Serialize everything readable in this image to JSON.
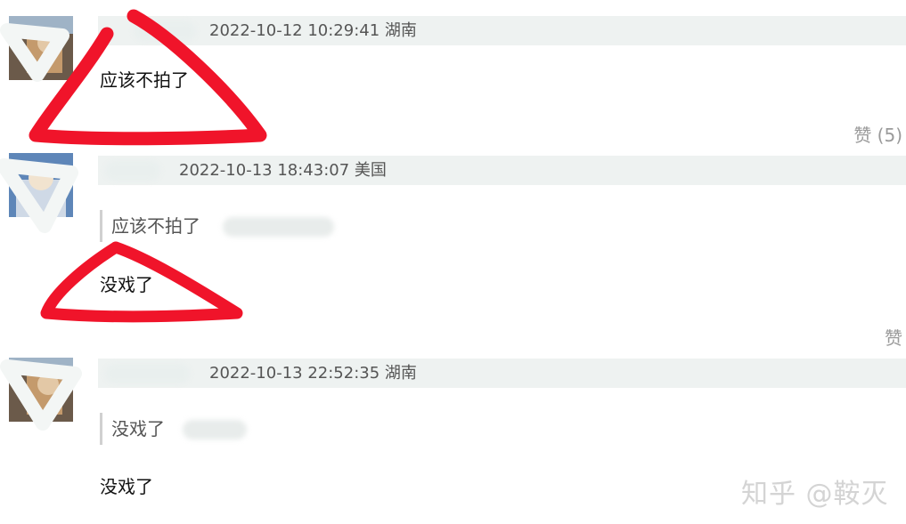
{
  "comments": [
    {
      "time": "2022-10-12 10:29:41",
      "location": "湖南",
      "text": "应该不拍了",
      "like_label": "赞 (5)"
    },
    {
      "time": "2022-10-13 18:43:07",
      "location": "美国",
      "quote": "应该不拍了",
      "text": "没戏了",
      "like_label": "赞"
    },
    {
      "time": "2022-10-13 22:52:35",
      "location": "湖南",
      "quote": "没戏了",
      "text": "没戏了"
    }
  ],
  "watermark": "知乎 @鞍灭",
  "colors": {
    "header_bg": "#eef2f1",
    "annotation_red": "#f0142a",
    "like_gray": "#9a9a9a"
  }
}
